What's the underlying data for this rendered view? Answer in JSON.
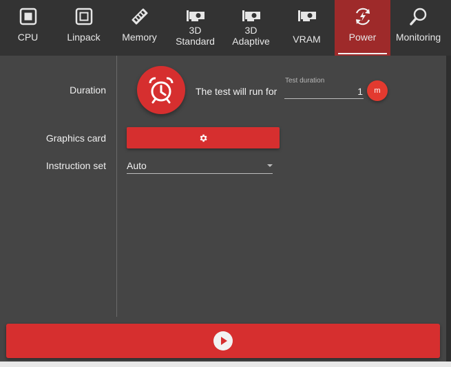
{
  "tabs": [
    {
      "label": "CPU",
      "icon": "cpu-icon",
      "active": false
    },
    {
      "label": "Linpack",
      "icon": "linpack-icon",
      "active": false
    },
    {
      "label": "Memory",
      "icon": "memory-icon",
      "active": false
    },
    {
      "label": "3D\nStandard",
      "icon": "graphics-card-icon",
      "active": false
    },
    {
      "label": "3D\nAdaptive",
      "icon": "graphics-card-icon",
      "active": false
    },
    {
      "label": "VRAM",
      "icon": "graphics-card-icon",
      "active": false
    },
    {
      "label": "Power",
      "icon": "power-icon",
      "active": true
    },
    {
      "label": "Monitoring",
      "icon": "magnifier-icon",
      "active": false
    }
  ],
  "duration": {
    "label": "Duration",
    "run_text": "The test will run for",
    "caption": "Test duration",
    "value": "1",
    "unit": "m"
  },
  "graphics_card": {
    "label": "Graphics card",
    "button_icon": "gear-icon"
  },
  "instruction_set": {
    "label": "Instruction set",
    "value": "Auto"
  },
  "start_button": {
    "icon": "play-icon"
  },
  "colors": {
    "accent": "#d62f2f",
    "active_tab": "#9e2a2a",
    "background": "#454545",
    "tabbar": "#333333"
  }
}
